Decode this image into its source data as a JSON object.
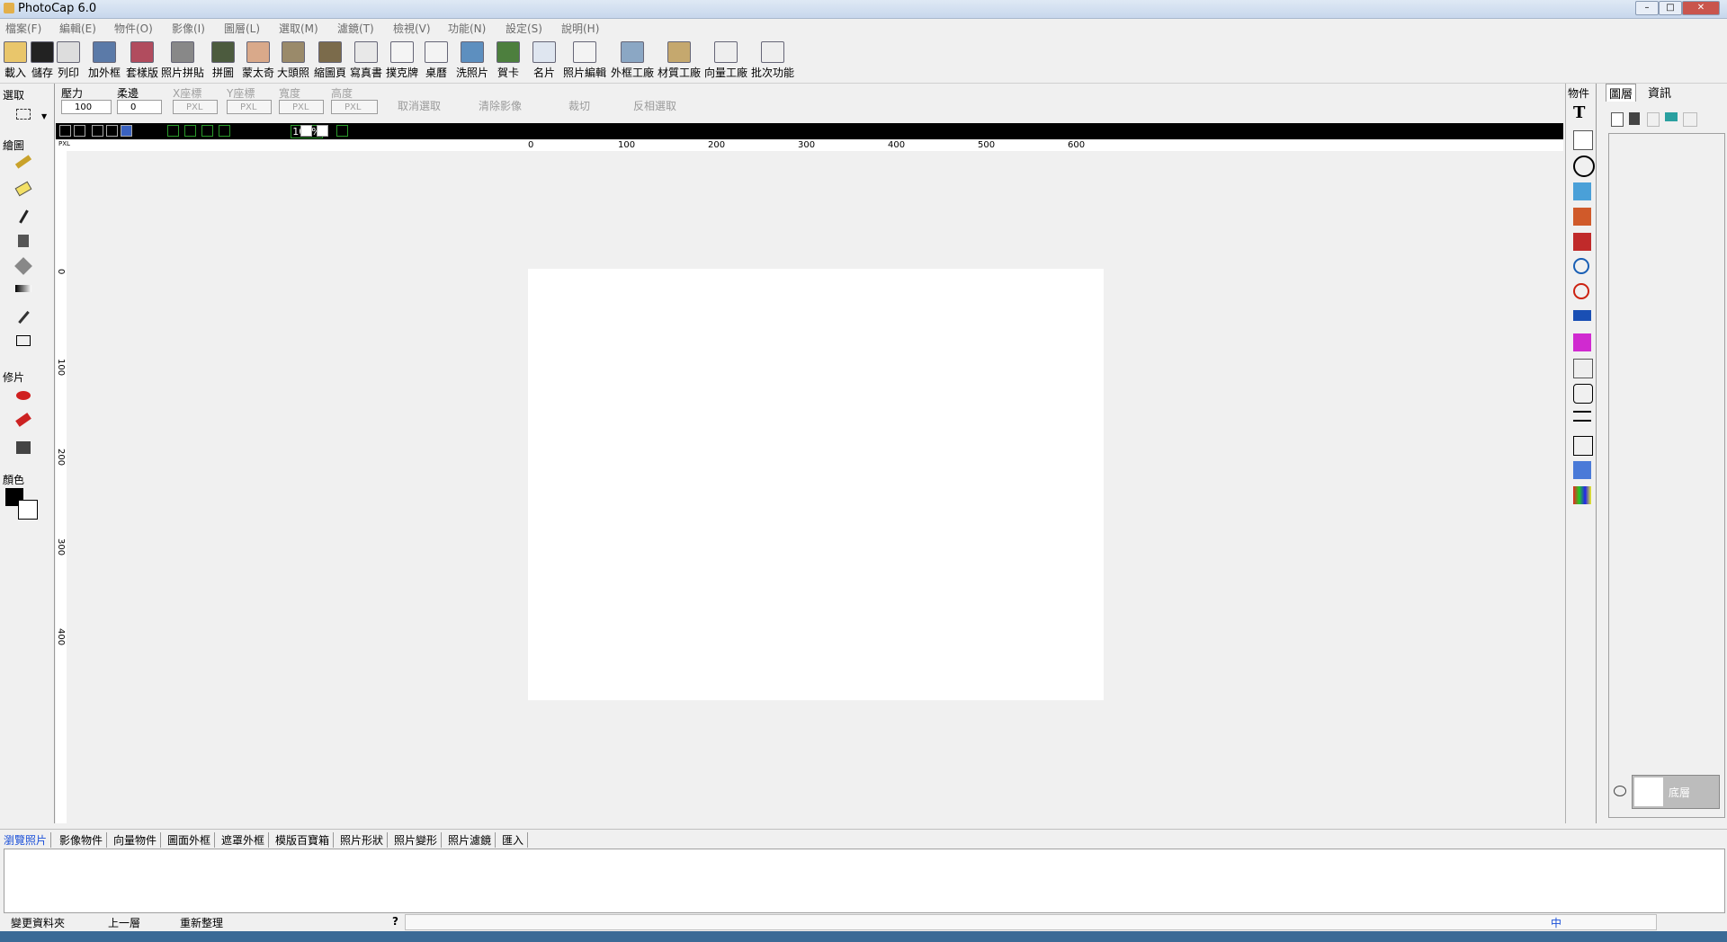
{
  "window": {
    "title": "PhotoCap 6.0",
    "min": "–",
    "max": "□",
    "close": "✕"
  },
  "menu": [
    "檔案(F)",
    "編輯(E)",
    "物件(O)",
    "影像(I)",
    "圖層(L)",
    "選取(M)",
    "濾鏡(T)",
    "檢視(V)",
    "功能(N)",
    "設定(S)",
    "說明(H)"
  ],
  "toolbar": [
    "載入",
    "儲存",
    "列印",
    "加外框",
    "套樣版",
    "照片拼貼",
    "拼圖",
    "蒙太奇",
    "大頭照",
    "縮圖頁",
    "寫真書",
    "撲克牌",
    "桌曆",
    "洗照片",
    "賀卡",
    "名片",
    "照片編輯",
    "外框工廠",
    "材質工廠",
    "向量工廠",
    "批次功能"
  ],
  "left": {
    "select": "選取",
    "draw": "繪圖",
    "retouch": "修片",
    "color": "顏色"
  },
  "options": {
    "pressure": "壓力",
    "pressure_val": "100",
    "feather": "柔邊",
    "feather_val": "0",
    "x": "X座標",
    "y": "Y座標",
    "w": "寬度",
    "h": "高度",
    "px": "PXL",
    "cancel": "取消選取",
    "clear": "清除影像",
    "cut": "裁切",
    "invert": "反相選取"
  },
  "zoom": "100%",
  "ruler_top": [
    "0",
    "100",
    "200",
    "300",
    "400",
    "500",
    "600"
  ],
  "ruler_left": [
    "0",
    "100",
    "200",
    "300",
    "400"
  ],
  "ruler_unit": "PXL",
  "right": {
    "objects": "物件",
    "tab_layers": "圖層",
    "tab_info": "資訊",
    "layer_name": "底層"
  },
  "bottomtabs": [
    "瀏覽照片",
    "影像物件",
    "向量物件",
    "圖面外框",
    "遮罩外框",
    "模版百寶箱",
    "照片形狀",
    "照片變形",
    "照片濾鏡",
    "匯入"
  ],
  "status": {
    "change_folder": "變更資料夾",
    "up": "上一層",
    "refresh": "重新整理",
    "help": "?",
    "ime": "中"
  }
}
